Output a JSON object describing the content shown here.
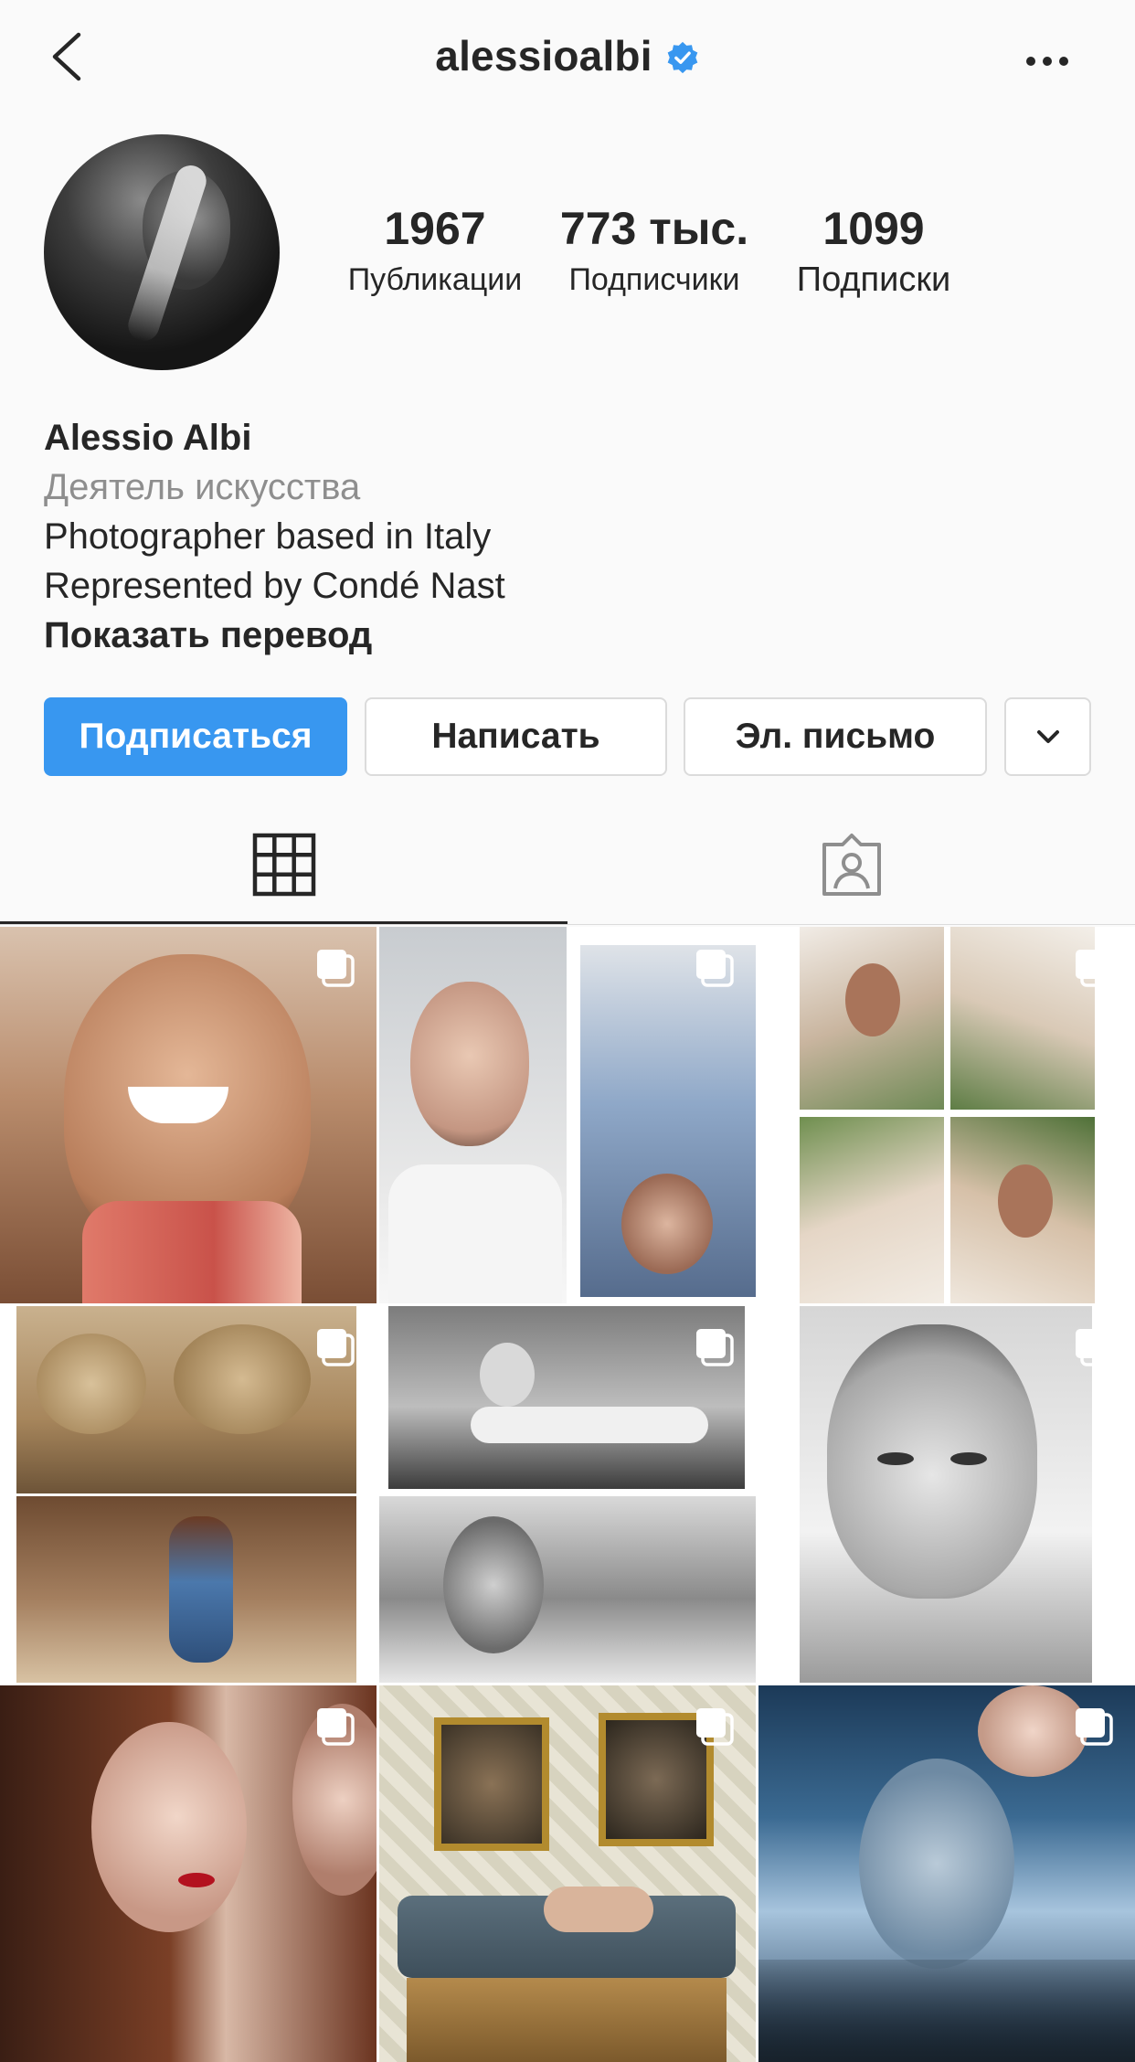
{
  "header": {
    "username": "alessioalbi",
    "verified_icon": "verified-badge-icon",
    "back_icon": "chevron-left-icon",
    "more_icon": "more-horizontal-icon"
  },
  "profile": {
    "stats": [
      {
        "value": "1967",
        "label": "Публикации"
      },
      {
        "value": "773 тыс.",
        "label": "Подписчики"
      },
      {
        "value": "1099",
        "label": "Подписки"
      }
    ],
    "name": "Alessio Albi",
    "category": "Деятель искусства",
    "bio_lines": [
      "Photographer based in Italy",
      "Represented by Condé Nast"
    ],
    "translate_label": "Показать перевод"
  },
  "actions": {
    "follow_label": "Подписаться",
    "message_label": "Написать",
    "email_label": "Эл. письмо",
    "more_icon": "chevron-down-icon"
  },
  "tabs": [
    {
      "name": "grid",
      "icon": "grid-icon",
      "active": true
    },
    {
      "name": "tagged",
      "icon": "tagged-user-icon",
      "active": false
    }
  ],
  "colors": {
    "accent": "#3897f0",
    "text": "#262626",
    "secondary_text": "#8e8e8e",
    "border": "#dbdbdb",
    "background": "#fafafa"
  },
  "posts": [
    {
      "type": "multi",
      "depicts": "smiling woman holding grapefruit"
    },
    {
      "type": "multi",
      "depicts": "portrait of woman and man lying on bed"
    },
    {
      "type": "multi",
      "depicts": "woman among palm leaves collage"
    },
    {
      "type": "multi",
      "depicts": "hay bales and woman in barn"
    },
    {
      "type": "multi",
      "depicts": "black and white woman lying on floor"
    },
    {
      "type": "multi",
      "depicts": "freckled woman black and white portrait"
    },
    {
      "type": "multi",
      "depicts": "two women with red lips"
    },
    {
      "type": "multi",
      "depicts": "woman on sofa below portraits"
    },
    {
      "type": "multi",
      "depicts": "woman reflected behind glass with trees"
    }
  ]
}
